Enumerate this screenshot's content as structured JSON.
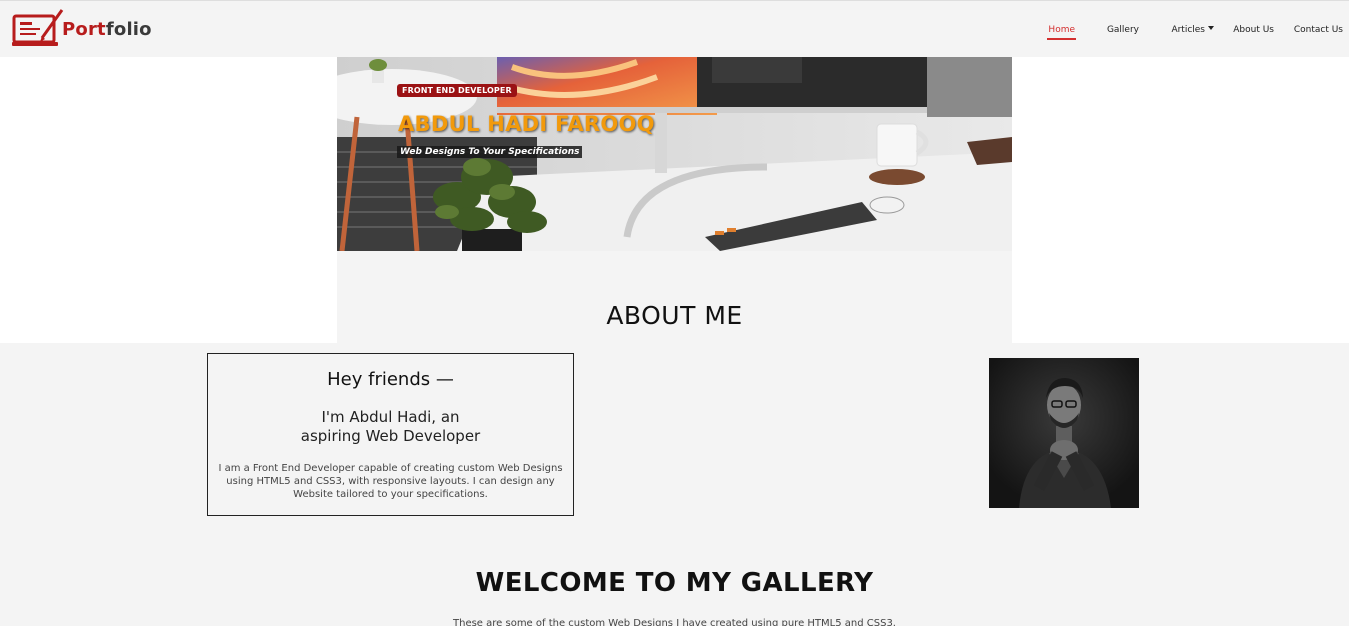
{
  "brand": {
    "logo_text_accent": "Port",
    "logo_text_rest": "folio",
    "accent_color": "#b71c1c"
  },
  "nav": {
    "items": [
      {
        "label": "Home",
        "active": true
      },
      {
        "label": "Gallery"
      },
      {
        "label": "Articles",
        "has_dropdown": true
      },
      {
        "label": "About Us"
      },
      {
        "label": "Contact Us"
      }
    ]
  },
  "hero": {
    "badge": "FRONT END DEVELOPER",
    "name": "ABDUL HADI FAROOQ",
    "tagline": "Web Designs To Your Specifications",
    "name_color": "#f29a0c"
  },
  "about": {
    "title": "ABOUT ME",
    "greeting": "Hey friends —",
    "subtitle_line1": "I'm Abdul Hadi, an",
    "subtitle_line2": "aspiring Web Developer",
    "body": "I am a Front End Developer capable of creating custom Web Designs using HTML5 and CSS3, with responsive layouts. I can design any Website tailored to your specifications."
  },
  "gallery": {
    "title": "WELCOME TO MY GALLERY",
    "description": "These are some of the custom Web Designs I have created using pure HTML5 and CSS3."
  }
}
